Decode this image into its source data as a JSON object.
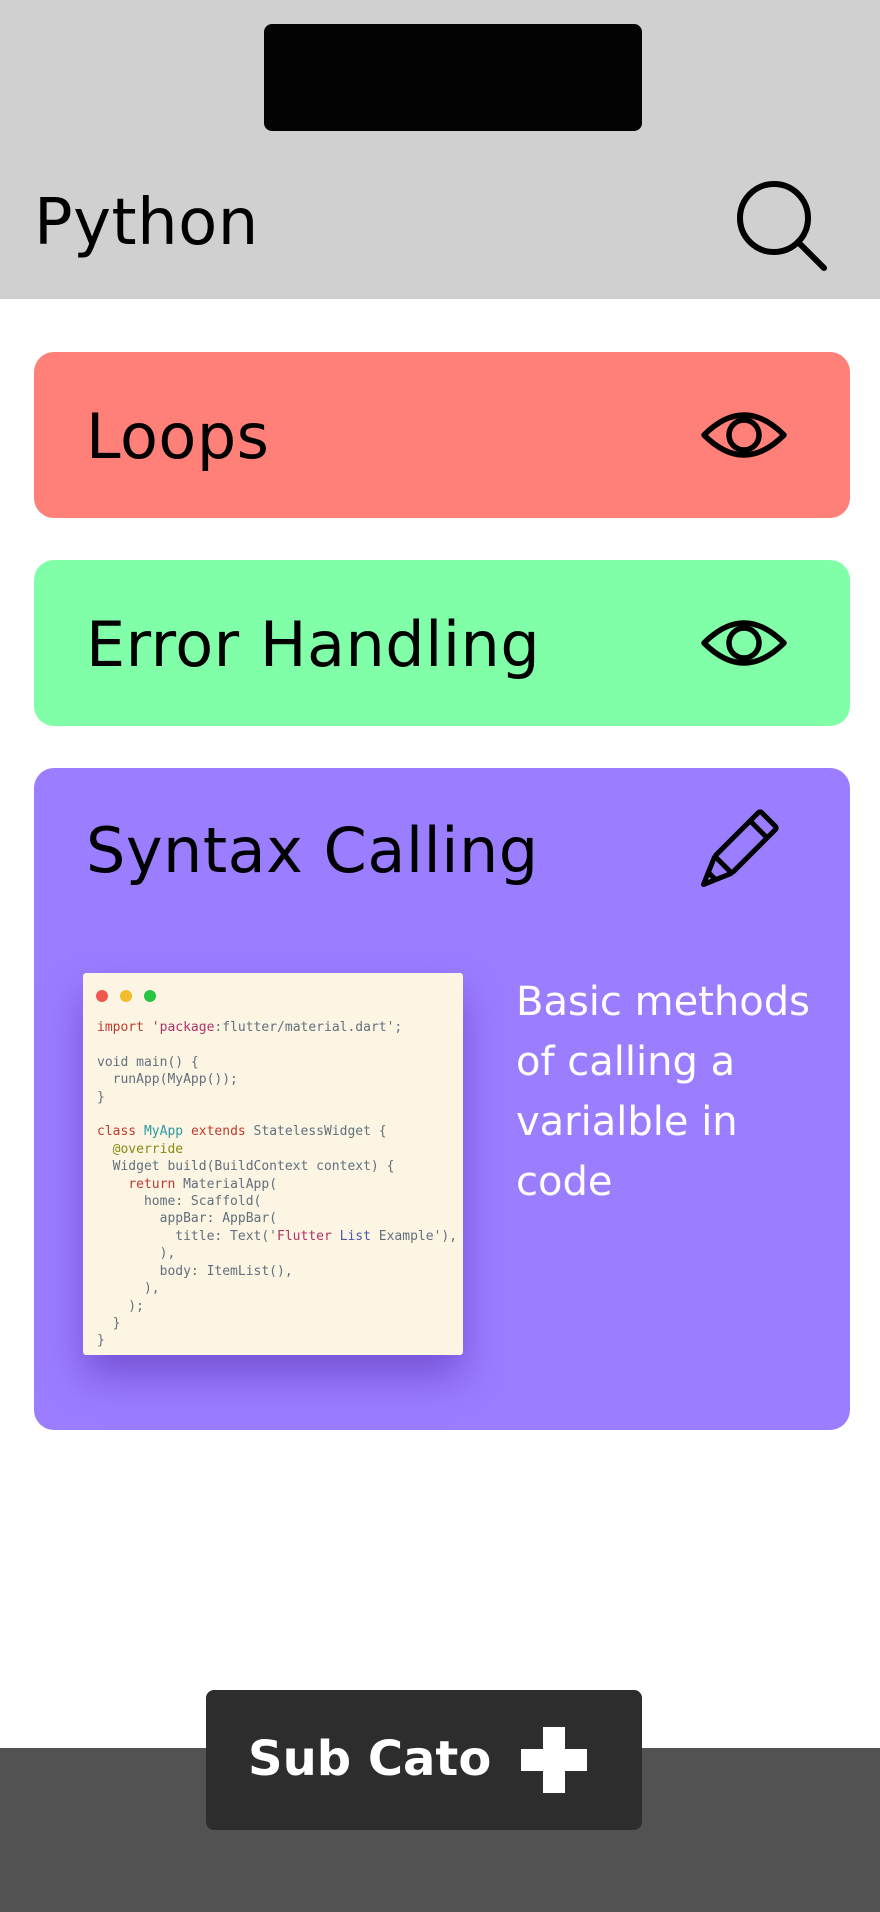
{
  "header": {
    "title": "Python",
    "search_icon": "search-icon",
    "background": "#d0d0d0"
  },
  "cards": [
    {
      "title": "Loops",
      "icon": "eye-icon",
      "color": "#ff7f79"
    },
    {
      "title": "Error Handling",
      "icon": "eye-icon",
      "color": "#80fea8"
    },
    {
      "title": "Syntax Calling",
      "icon": "pencil-icon",
      "color": "#9b7dff",
      "description": "Basic methods of calling a varialble in code",
      "code_lines": [
        "import 'package:flutter/material.dart';",
        "",
        "void main() {",
        "  runApp(MyApp());",
        "}",
        "",
        "class MyApp extends StatelessWidget {",
        "  @override",
        "  Widget build(BuildContext context) {",
        "    return MaterialApp(",
        "      home: Scaffold(",
        "        appBar: AppBar(",
        "          title: Text('Flutter List Example'),",
        "        ),",
        "        body: ItemList(),",
        "      ),",
        "    );",
        "  }",
        "}"
      ]
    }
  ],
  "fab": {
    "label": "Sub Cato",
    "icon": "plus-icon"
  }
}
